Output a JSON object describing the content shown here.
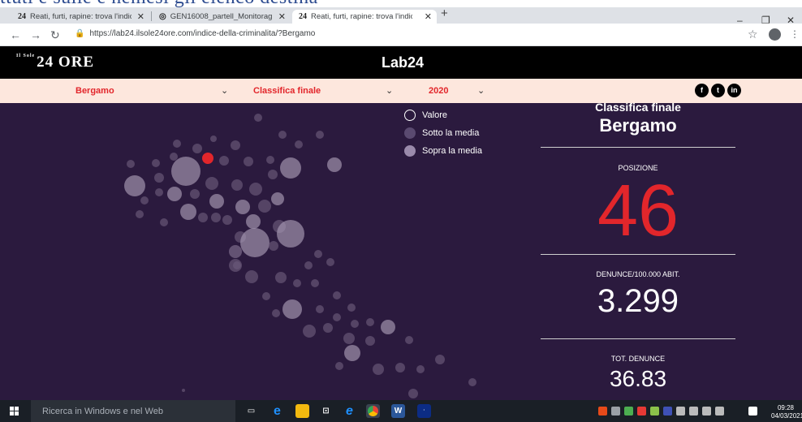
{
  "top_strip_text": "ttuti e sulle e nemesi gli elenco destina",
  "browser": {
    "tabs": [
      {
        "favicon": "24",
        "title": "Reati, furti, rapine: trova l'indice",
        "active": false
      },
      {
        "favicon": "chrome-icon",
        "title": "GEN16008_partell_Monitoraggio",
        "active": false
      },
      {
        "favicon": "24",
        "title": "Reati, furti, rapine: trova l'indice",
        "active": true
      }
    ],
    "url": "https://lab24.ilsole24ore.com/indice-della-criminalita/?Bergamo",
    "window_controls": [
      "–",
      "❐",
      "✕"
    ]
  },
  "site": {
    "logo": "24 ORE",
    "logo_prefix": "Il Sole",
    "lab_logo": "Lab24"
  },
  "filters": {
    "city": "Bergamo",
    "ranking": "Classifica finale",
    "year": "2020"
  },
  "social_icons": [
    "facebook-icon",
    "twitter-icon",
    "linkedin-icon"
  ],
  "legend": [
    {
      "label": "Valore",
      "style": "outline"
    },
    {
      "label": "Sotto la media",
      "style": "dark"
    },
    {
      "label": "Sopra la media",
      "style": "light"
    }
  ],
  "panel": {
    "heading": "Classifica finale",
    "city": "Bergamo",
    "position_label": "POSIZIONE",
    "position_value": "46",
    "denunce_label": "DENUNCE/100.000 ABIT.",
    "denunce_value": "3.299",
    "tot_label": "TOT. DENUNCE",
    "tot_value": "36.83"
  },
  "taskbar": {
    "search_placeholder": "Ricerca in Windows e nel Web",
    "time": "09:28",
    "date": "04/03/2021"
  },
  "colors": {
    "accent": "#e2262b",
    "map_bg": "#2b1a3e",
    "filter_bg": "#fde7dd"
  }
}
